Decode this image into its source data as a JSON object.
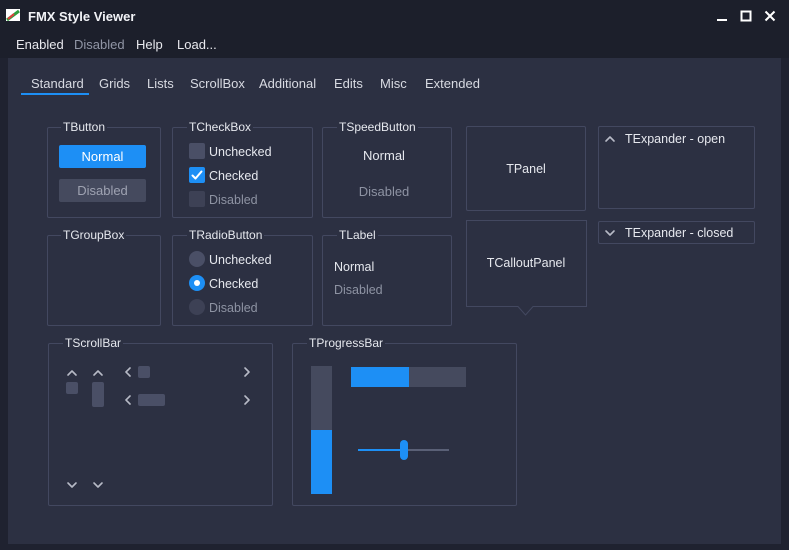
{
  "window": {
    "title": "FMX Style Viewer"
  },
  "menu": [
    "Enabled",
    "Disabled",
    "Help",
    "Load..."
  ],
  "tabs": [
    "Standard",
    "Grids",
    "Lists",
    "ScrollBox",
    "Additional",
    "Edits",
    "Misc",
    "Extended"
  ],
  "active_tab": "Standard",
  "accent_color": "#1d8ff5",
  "tbutton": {
    "title": "TButton",
    "normal": "Normal",
    "disabled": "Disabled"
  },
  "tcheckbox": {
    "title": "TCheckBox",
    "unchecked": "Unchecked",
    "checked": "Checked",
    "disabled": "Disabled"
  },
  "tspeedbutton": {
    "title": "TSpeedButton",
    "normal": "Normal",
    "disabled": "Disabled"
  },
  "tpanel": {
    "title": "TPanel"
  },
  "texpander_open": {
    "title": "TExpander - open"
  },
  "texpander_closed": {
    "title": "TExpander - closed"
  },
  "tgroupbox": {
    "title": "TGroupBox"
  },
  "tradiobutton": {
    "title": "TRadioButton",
    "unchecked": "Unchecked",
    "checked": "Checked",
    "disabled": "Disabled"
  },
  "tlabel": {
    "title": "TLabel",
    "normal": "Normal",
    "disabled": "Disabled"
  },
  "tcalloutpanel": {
    "title": "TCalloutPanel"
  },
  "tscrollbar": {
    "title": "TScrollBar"
  },
  "tprogressbar": {
    "title": "TProgressBar",
    "horizontal_progress": 0.5,
    "vertical_progress": 0.5,
    "trackbar_value": 0.5
  }
}
